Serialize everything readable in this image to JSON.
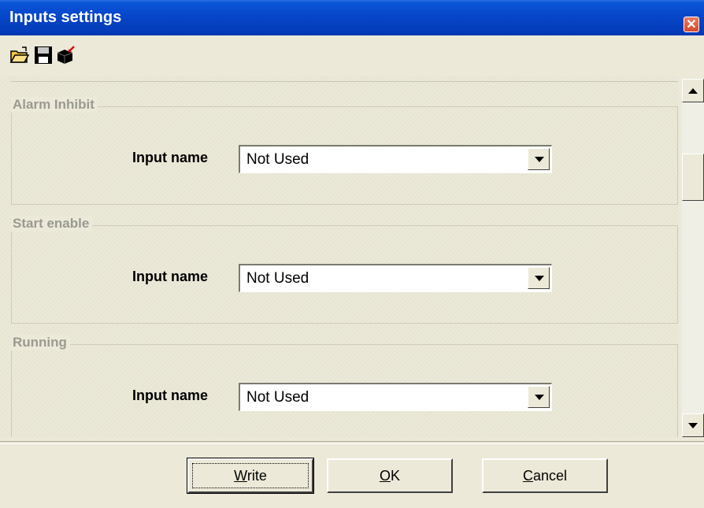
{
  "window": {
    "title": "Inputs settings",
    "close_glyph": "✕"
  },
  "toolbar": {
    "icons": [
      "open-folder-icon",
      "save-icon",
      "write-device-icon"
    ]
  },
  "groups": [
    {
      "legend": "Alarm Inhibit",
      "input_label": "Input name",
      "value": "Not Used"
    },
    {
      "legend": "Start enable",
      "input_label": "Input name",
      "value": "Not Used"
    },
    {
      "legend": "Running",
      "input_label": "Input name",
      "value": "Not Used"
    }
  ],
  "buttons": {
    "write": {
      "mnemonic": "W",
      "rest": "rite"
    },
    "ok": {
      "mnemonic": "O",
      "rest": "K"
    },
    "cancel": {
      "mnemonic": "C",
      "rest": "ancel"
    }
  },
  "colors": {
    "titlebar": "#0645c7",
    "face": "#ece9d8",
    "close": "#d8482a"
  }
}
